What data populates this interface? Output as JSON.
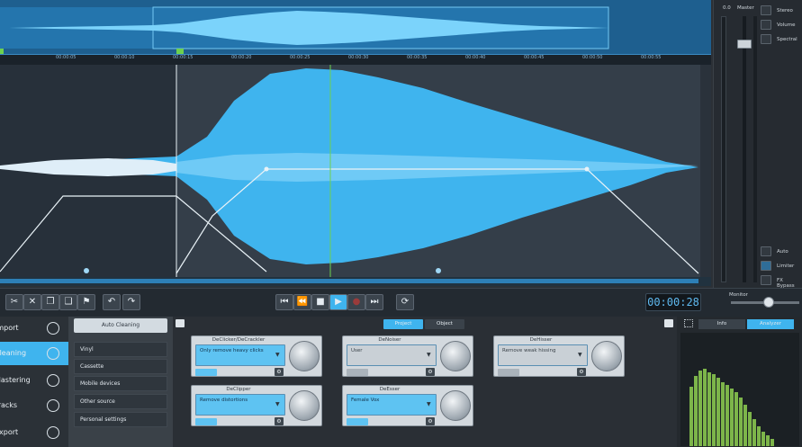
{
  "colors": {
    "accent": "#5ec3f2",
    "waveform": "#3fb4ee",
    "selection": "#1e6fa6",
    "analyzer": "#7db54a"
  },
  "ruler": {
    "ticks": [
      "00:00:05",
      "00:00:10",
      "00:00:15",
      "00:00:20",
      "00:00:25",
      "00:00:30",
      "00:00:35",
      "00:00:40",
      "00:00:45",
      "00:00:50",
      "00:00:55"
    ]
  },
  "meter": {
    "value": "0.0",
    "master_label": "Master",
    "monitor_label": "Monitor"
  },
  "side_options": {
    "top": [
      "Stereo",
      "Volume",
      "Spectral"
    ],
    "bottom": [
      "Auto",
      "Limiter",
      "FX Bypass"
    ]
  },
  "transport": {
    "timecode": "00:00:28"
  },
  "nav": {
    "items": [
      "Import",
      "Cleaning",
      "Mastering",
      "Tracks",
      "Export"
    ],
    "active": 1
  },
  "categories": {
    "auto_cleaning": "Auto Cleaning",
    "items": [
      "Vinyl",
      "Cassette",
      "Mobile devices",
      "Other source",
      "Personal settings"
    ]
  },
  "tabs": {
    "project": "Project",
    "object": "Object",
    "info": "Info",
    "analyzer": "Analyzer"
  },
  "modules": [
    {
      "title": "DeClicker/DeCrackler",
      "value": "Only remove heavy clicks",
      "active": true
    },
    {
      "title": "DeNoiser",
      "value": "User",
      "active": false
    },
    {
      "title": "DeHisser",
      "value": "Remove weak hissing",
      "active": false
    },
    {
      "title": "DeClipper",
      "value": "Remove distortions",
      "active": true
    },
    {
      "title": "DeEsser",
      "value": "Female Vox",
      "active": true
    }
  ]
}
